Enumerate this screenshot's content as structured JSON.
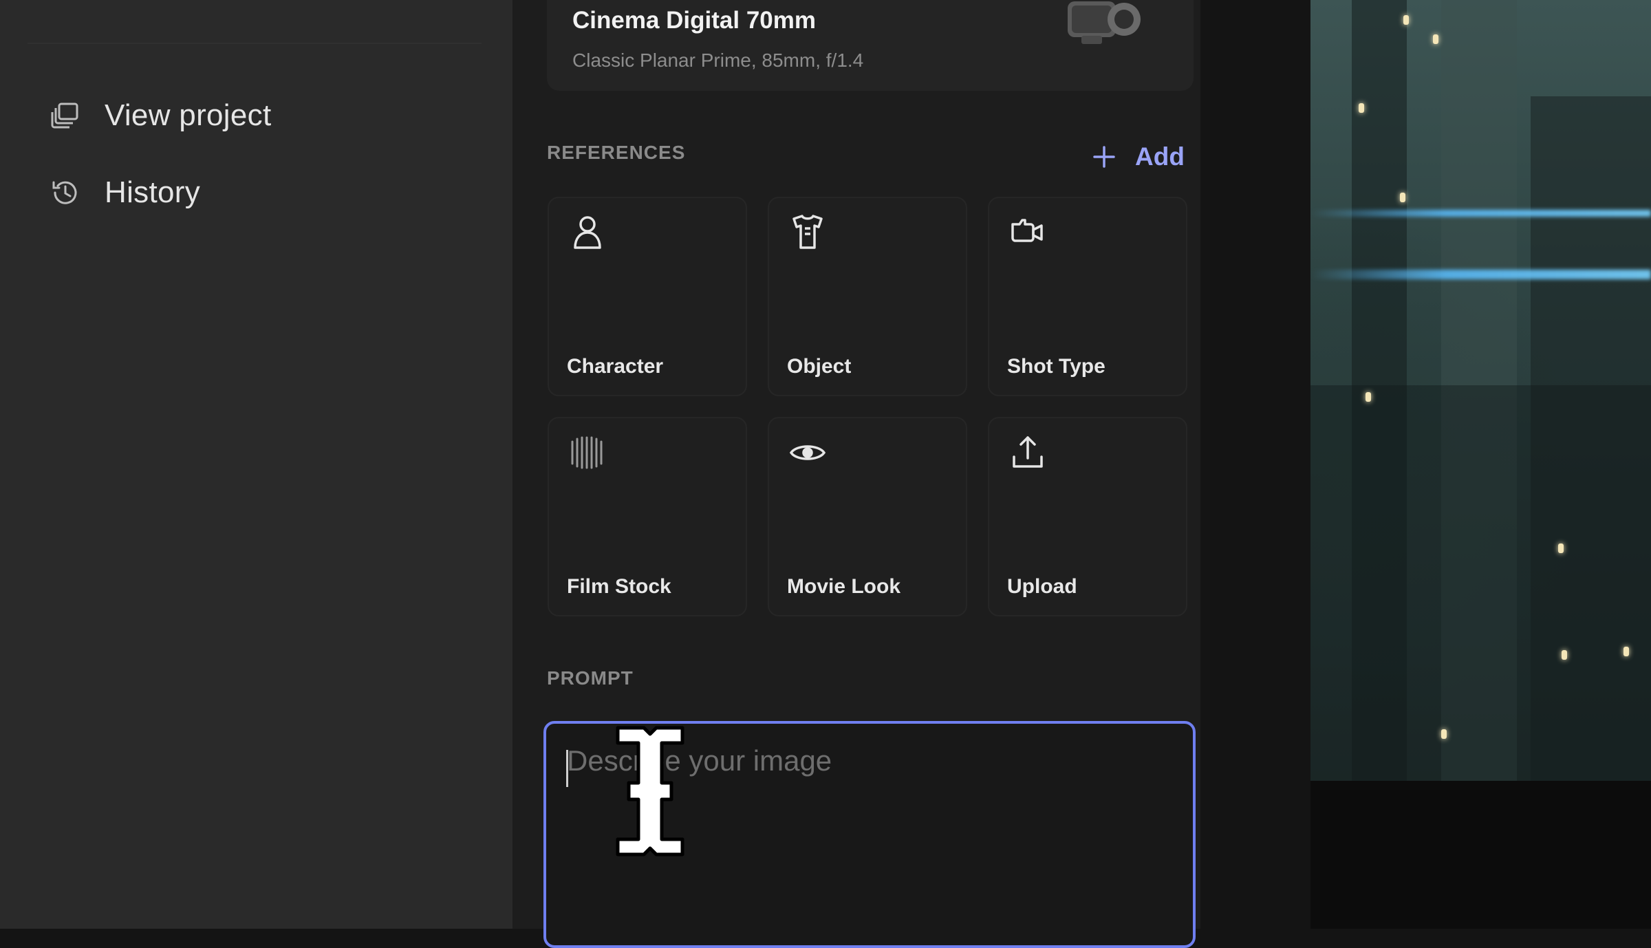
{
  "sidebar": {
    "items": [
      {
        "label": "View project",
        "icon": "layers-icon"
      },
      {
        "label": "History",
        "icon": "history-icon"
      }
    ]
  },
  "camera": {
    "title": "Cinema Digital 70mm",
    "subtitle": "Classic Planar Prime, 85mm, f/1.4",
    "icon": "camera-icon"
  },
  "references": {
    "label": "REFERENCES",
    "add_label": "Add",
    "cards": [
      {
        "label": "Character",
        "icon": "person-icon"
      },
      {
        "label": "Object",
        "icon": "shirt-icon"
      },
      {
        "label": "Shot Type",
        "icon": "video-camera-icon"
      },
      {
        "label": "Film Stock",
        "icon": "film-stock-icon"
      },
      {
        "label": "Movie Look",
        "icon": "eye-icon"
      },
      {
        "label": "Upload",
        "icon": "upload-icon"
      }
    ]
  },
  "prompt": {
    "label": "PROMPT",
    "placeholder": "Describe your image",
    "value": ""
  },
  "colors": {
    "accent": "#6f7ff0",
    "add_text": "#9aa4f7",
    "sidebar_bg": "#2a2a2a",
    "panel_bg": "#1d1d1d"
  }
}
